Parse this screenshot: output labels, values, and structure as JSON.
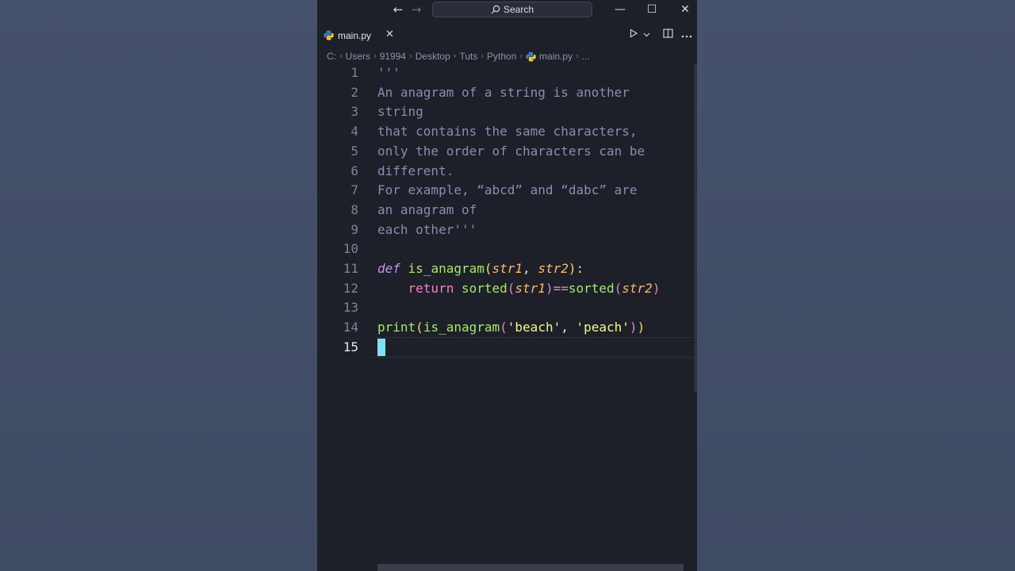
{
  "titlebar": {
    "search_label": "Search",
    "minimize": "—",
    "maximize": "☐",
    "close": "✕"
  },
  "tab": {
    "label": "main.py",
    "close": "✕"
  },
  "breadcrumb": [
    "C:",
    "Users",
    "91994",
    "Desktop",
    "Tuts",
    "Python",
    "main.py",
    "..."
  ],
  "editor": {
    "active_line": 15,
    "lines": [
      {
        "n": "1",
        "text": "'''"
      },
      {
        "n": "2",
        "text": "An anagram of a string is another"
      },
      {
        "n": "3",
        "text": "string"
      },
      {
        "n": "4",
        "text": "that contains the same characters,"
      },
      {
        "n": "5",
        "text": "only the order of characters can be"
      },
      {
        "n": "6",
        "text": "different."
      },
      {
        "n": "7",
        "text": "For example, “abcd” and “dabc” are"
      },
      {
        "n": "8",
        "text": "an anagram of"
      },
      {
        "n": "9",
        "text": "each other'''"
      },
      {
        "n": "10",
        "text": ""
      },
      {
        "n": "11",
        "text": "def is_anagram(str1, str2):"
      },
      {
        "n": "12",
        "text": "    return sorted(str1)==sorted(str2)"
      },
      {
        "n": "13",
        "text": ""
      },
      {
        "n": "14",
        "text": "print(is_anagram('beach', 'peach'))"
      },
      {
        "n": "15",
        "text": ""
      }
    ],
    "tokens": {
      "def": "def",
      "fn_name": "is_anagram",
      "open_paren": "(",
      "p1": "str1",
      "comma": ", ",
      "p2": "str2",
      "close_colon": "):",
      "return": "return",
      "sorted1": "sorted",
      "sorted2": "sorted",
      "eq": "==",
      "print": "print",
      "s1": "'beach'",
      "s2": "'peach'"
    }
  },
  "colors": {
    "background": "#1d2029",
    "comment": "#8590b0",
    "keyword": "#c792ea",
    "function": "#a5e86b",
    "string": "#f1fa8c",
    "cursor": "#80e1f0"
  }
}
